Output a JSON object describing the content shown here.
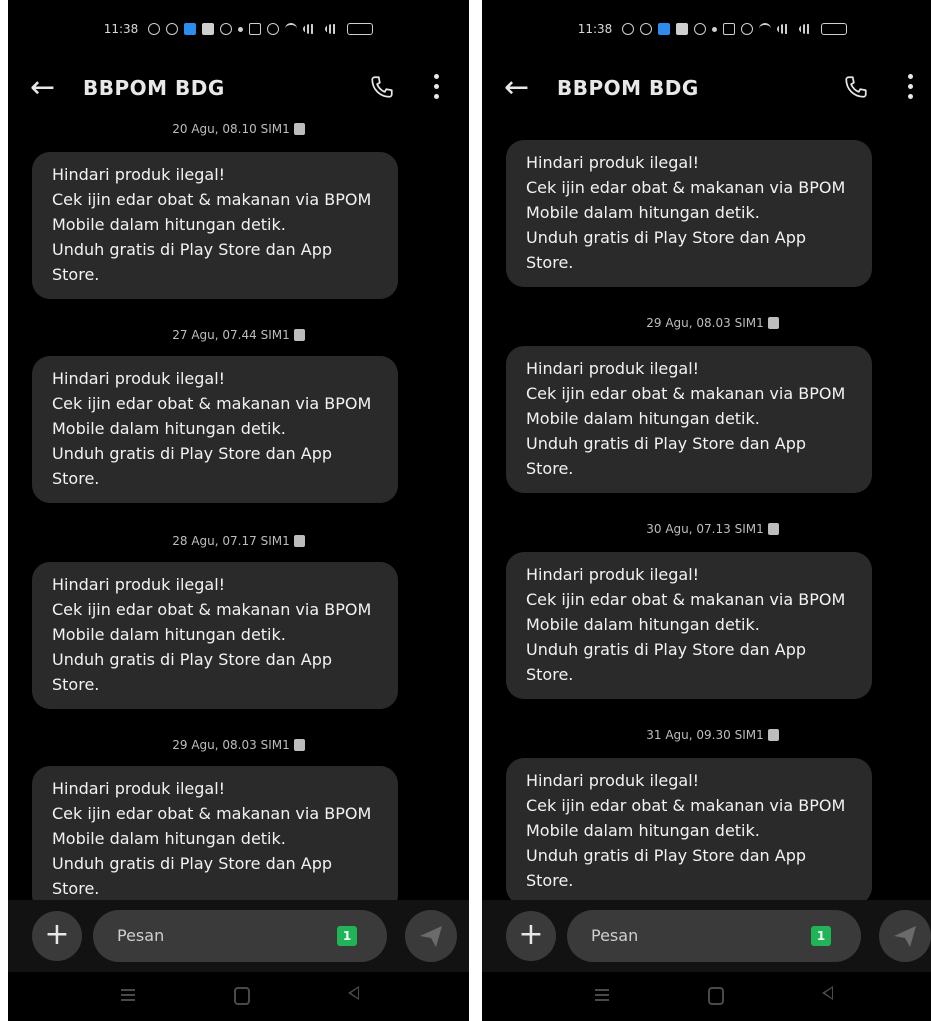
{
  "status_bar": {
    "time": "11:38"
  },
  "conversation": {
    "contact_name": "BBPOM BDG"
  },
  "compose": {
    "placeholder": "Pesan",
    "sim_badge": "1"
  },
  "left_screen": {
    "messages": [
      {
        "timestamp": "20 Agu, 08.10 SIM1",
        "lines": [
          "Hindari produk ilegal!",
          "Cek ijin edar obat & makanan via BPOM",
          "Mobile dalam hitungan detik.",
          "Unduh gratis di Play Store dan App",
          "Store."
        ]
      },
      {
        "timestamp": "27 Agu, 07.44 SIM1",
        "lines": [
          "Hindari produk ilegal!",
          "Cek ijin edar obat & makanan via BPOM",
          "Mobile dalam hitungan detik.",
          "Unduh gratis di Play Store dan App",
          "Store."
        ]
      },
      {
        "timestamp": "28 Agu, 07.17 SIM1",
        "lines": [
          "Hindari produk ilegal!",
          "Cek ijin edar obat & makanan via BPOM",
          "Mobile dalam hitungan detik.",
          "Unduh gratis di Play Store dan App",
          "Store."
        ]
      },
      {
        "timestamp": "29 Agu, 08.03 SIM1",
        "lines": [
          "Hindari produk ilegal!",
          "Cek ijin edar obat & makanan via BPOM",
          "Mobile dalam hitungan detik.",
          "Unduh gratis di Play Store dan App",
          "Store."
        ]
      }
    ]
  },
  "right_screen": {
    "messages": [
      {
        "timestamp": "",
        "lines": [
          "Hindari produk ilegal!",
          "Cek ijin edar obat & makanan via BPOM",
          "Mobile dalam hitungan detik.",
          "Unduh gratis di Play Store dan App",
          "Store."
        ]
      },
      {
        "timestamp": "29 Agu, 08.03 SIM1",
        "lines": [
          "Hindari produk ilegal!",
          "Cek ijin edar obat & makanan via BPOM",
          "Mobile dalam hitungan detik.",
          "Unduh gratis di Play Store dan App",
          "Store."
        ]
      },
      {
        "timestamp": "30 Agu, 07.13 SIM1",
        "lines": [
          "Hindari produk ilegal!",
          "Cek ijin edar obat & makanan via BPOM",
          "Mobile dalam hitungan detik.",
          "Unduh gratis di Play Store dan App",
          "Store."
        ]
      },
      {
        "timestamp": "31 Agu, 09.30 SIM1",
        "lines": [
          "Hindari produk ilegal!",
          "Cek ijin edar obat & makanan via BPOM",
          "Mobile dalam hitungan detik.",
          "Unduh gratis di Play Store dan App",
          "Store."
        ]
      }
    ]
  },
  "colors": {
    "background": "#000000",
    "bubble": "#2a2a2a",
    "sim_badge": "#1fb556"
  },
  "icons": [
    "back-arrow-icon",
    "phone-call-icon",
    "more-vert-icon",
    "add-icon",
    "send-icon",
    "sim-icon",
    "recent-apps-icon",
    "home-icon",
    "nav-back-icon"
  ]
}
